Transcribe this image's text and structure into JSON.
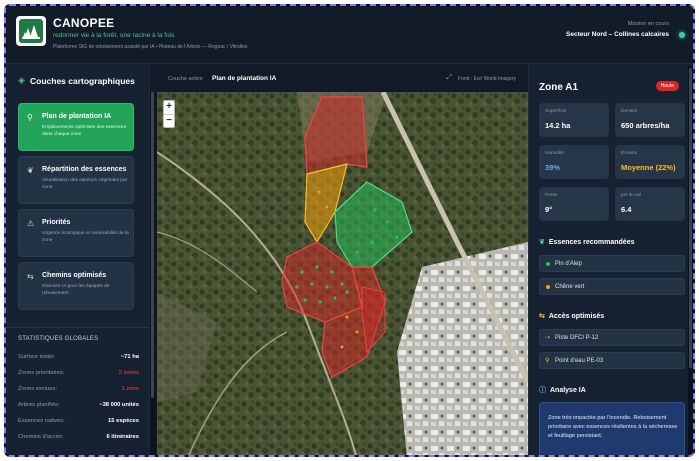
{
  "header": {
    "app_name": "CANOPEE",
    "tagline": "redonner vie à la forêt, une racine à la fois",
    "subtitle": "Plateforme SIG de reboisement assisté par IA • Plateau de l'Arbois — Rognac / Vitrolles",
    "mission_label": "Mission en cours",
    "mission_value": "Secteur Nord – Collines calcaires",
    "status_color": "#34d399"
  },
  "left_panel": {
    "title": "Couches cartographiques",
    "title_icon": "layers-icon",
    "layers": [
      {
        "name": "Plan de plantation IA",
        "desc": "Emplacements optimisés des essences dans chaque zone",
        "icon": "map-pin-icon",
        "active": true
      },
      {
        "name": "Répartition des essences",
        "desc": "Visualisation des espèces végétales par zone",
        "icon": "leaf-icon",
        "active": false
      },
      {
        "name": "Priorités",
        "desc": "Urgence écologique et vulnérabilité de la zone",
        "icon": "warning-icon",
        "active": false
      },
      {
        "name": "Chemins optimisés",
        "desc": "Itinéraire IA pour les équipes de reboisement",
        "icon": "route-icon",
        "active": false
      }
    ],
    "stats_title": "STATISTIQUES GLOBALES",
    "stats": [
      {
        "label": "Surface totale:",
        "value": "~71 ha",
        "red": false
      },
      {
        "label": "Zones prioritaires:",
        "value": "2 zones",
        "red": true
      },
      {
        "label": "Zones exclues:",
        "value": "1 zone",
        "red": true
      },
      {
        "label": "Arbres planifiés:",
        "value": "~38 000 unités",
        "red": false
      },
      {
        "label": "Essences natives:",
        "value": "15 espèces",
        "red": false
      },
      {
        "label": "Chemins d'accès:",
        "value": "6 itinéraires",
        "red": false
      }
    ]
  },
  "map": {
    "layer_label": "Couche active",
    "layer_value": "Plan de plantation IA",
    "background": "Fond : Esri World Imagery",
    "zoom_in": "+",
    "zoom_out": "−"
  },
  "right_panel": {
    "zone_title": "Zone A1",
    "badge": "Haute",
    "metrics": [
      {
        "label": "Superficie",
        "value": "14.2 ha",
        "color": "white"
      },
      {
        "label": "Densité",
        "value": "650 arbres/ha",
        "color": "white"
      },
      {
        "label": "Humidité",
        "value": "39%",
        "color": "blue"
      },
      {
        "label": "Érosion",
        "value": "Moyenne (22%)",
        "color": "yellow"
      },
      {
        "label": "Pente",
        "value": "9°",
        "color": "white"
      },
      {
        "label": "pH du sol",
        "value": "6.4",
        "color": "white"
      }
    ],
    "species_title": "Essences recommandées",
    "species": [
      {
        "name": "Pin d'Alep",
        "color": "#22c55e"
      },
      {
        "name": "Chêne vert",
        "color": "#f59e0b"
      }
    ],
    "access_title": "Accès optimisés",
    "access": [
      {
        "name": "Piste DFCI P-12"
      },
      {
        "name": "Point d'eau PE-03"
      }
    ],
    "analysis_title": "Analyse IA",
    "analysis_text": "Zone très impactée par l'incendie. Reboisement prioritaire avec essences résilientes à la sécheresse et feuillage persistant."
  }
}
